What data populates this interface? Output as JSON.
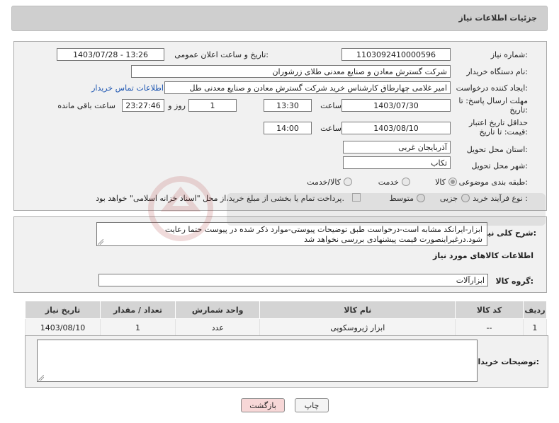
{
  "header": {
    "title": "جزئیات اطلاعات نیاز"
  },
  "form": {
    "need_number_label": "شماره نیاز:",
    "need_number": "1103092410000596",
    "announce_label": "تاریخ و ساعت اعلان عمومی:",
    "announce_value": "1403/07/28 - 13:26",
    "buyer_org_label": "نام دستگاه خریدار:",
    "buyer_org": "شرکت گسترش معادن و صنایع معدنی طلای زرشوران",
    "creator_label": "ایجاد کننده درخواست:",
    "creator": "امیر  غلامی چهارطاق کارشناس خرید شرکت گسترش معادن و صنایع معدنی طل",
    "contact_link": "اطلاعات تماس خریدار",
    "reply_deadline_label": "مهلت ارسال پاسخ: تا تاریخ:",
    "reply_date": "1403/07/30",
    "time_label": "ساعت",
    "reply_time": "13:30",
    "days_value": "1",
    "days_label": "روز و",
    "remaining_time": "23:27:46",
    "remaining_label": "ساعت باقی مانده",
    "price_validity_label": "حداقل تاریخ اعتبار قیمت: تا تاریخ:",
    "price_date": "1403/08/10",
    "price_time": "14:00",
    "province_label": "استان محل تحویل:",
    "province": "آذربایجان غربی",
    "city_label": "شهر محل تحویل:",
    "city": "تکاب",
    "category_label": "طبقه بندی موضوعی:",
    "category_options": [
      "کالا",
      "خدمت",
      "کالا/خدمت"
    ],
    "process_label": "نوع فرآیند خرید :",
    "process_options": [
      "جزیی",
      "متوسط"
    ],
    "payment_note": "پرداخت تمام یا بخشی از مبلغ خرید،از محل \"اسناد خزانه اسلامی\" خواهد بود."
  },
  "description": {
    "label": "شرح کلی نیاز:",
    "text": "ابزار-ایرانکد مشابه است-درخواست طبق توضیحات پیوستی-موارد ذکر شده در پیوست حتما رعایت شود.درغیراینصورت قیمت پیشنهادی بررسی نخواهد شد"
  },
  "goods": {
    "section_title": "اطلاعات کالاهای مورد نیاز",
    "group_label": "گروه کالا:",
    "group_value": "ابزارآلات",
    "columns": [
      "ردیف",
      "کد کالا",
      "نام کالا",
      "واحد شمارش",
      "تعداد / مقدار",
      "تاریخ نیاز"
    ],
    "rows": [
      {
        "row": "1",
        "code": "--",
        "name": "ابزار ژیروسکوپی",
        "unit": "عدد",
        "qty": "1",
        "date": "1403/08/10"
      }
    ]
  },
  "buyer_notes": {
    "label": "توضیحات خریدار:",
    "value": ""
  },
  "buttons": {
    "print": "چاپ",
    "back": "بازگشت"
  },
  "colors": {
    "header_bg": "#cfcfcf",
    "panel_bg": "#f1f1f1",
    "link": "#1a53b0",
    "back_button_bg": "#f7d7d7"
  }
}
